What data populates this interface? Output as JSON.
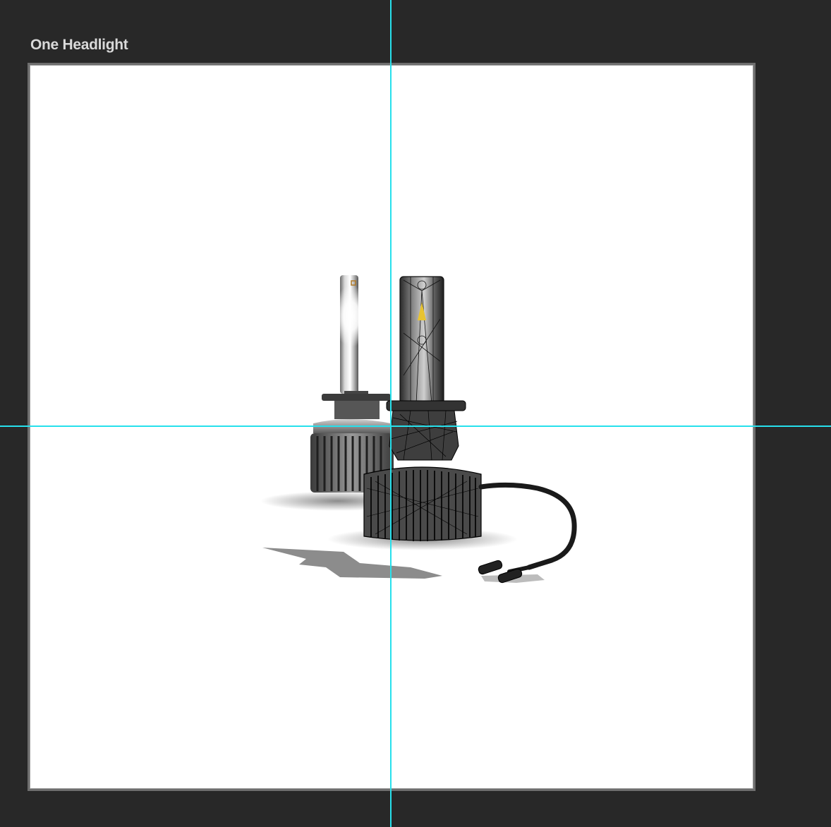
{
  "artboard": {
    "title": "One Headlight"
  },
  "canvas": {
    "background": "#ffffff",
    "workspace_color": "#282828",
    "guide_color": "#27e0ec"
  },
  "artwork": {
    "subject": "led-headlight-bulb-pair",
    "left_bulb": "rendered-chrome",
    "right_bulb": "wireframe-overlay"
  }
}
